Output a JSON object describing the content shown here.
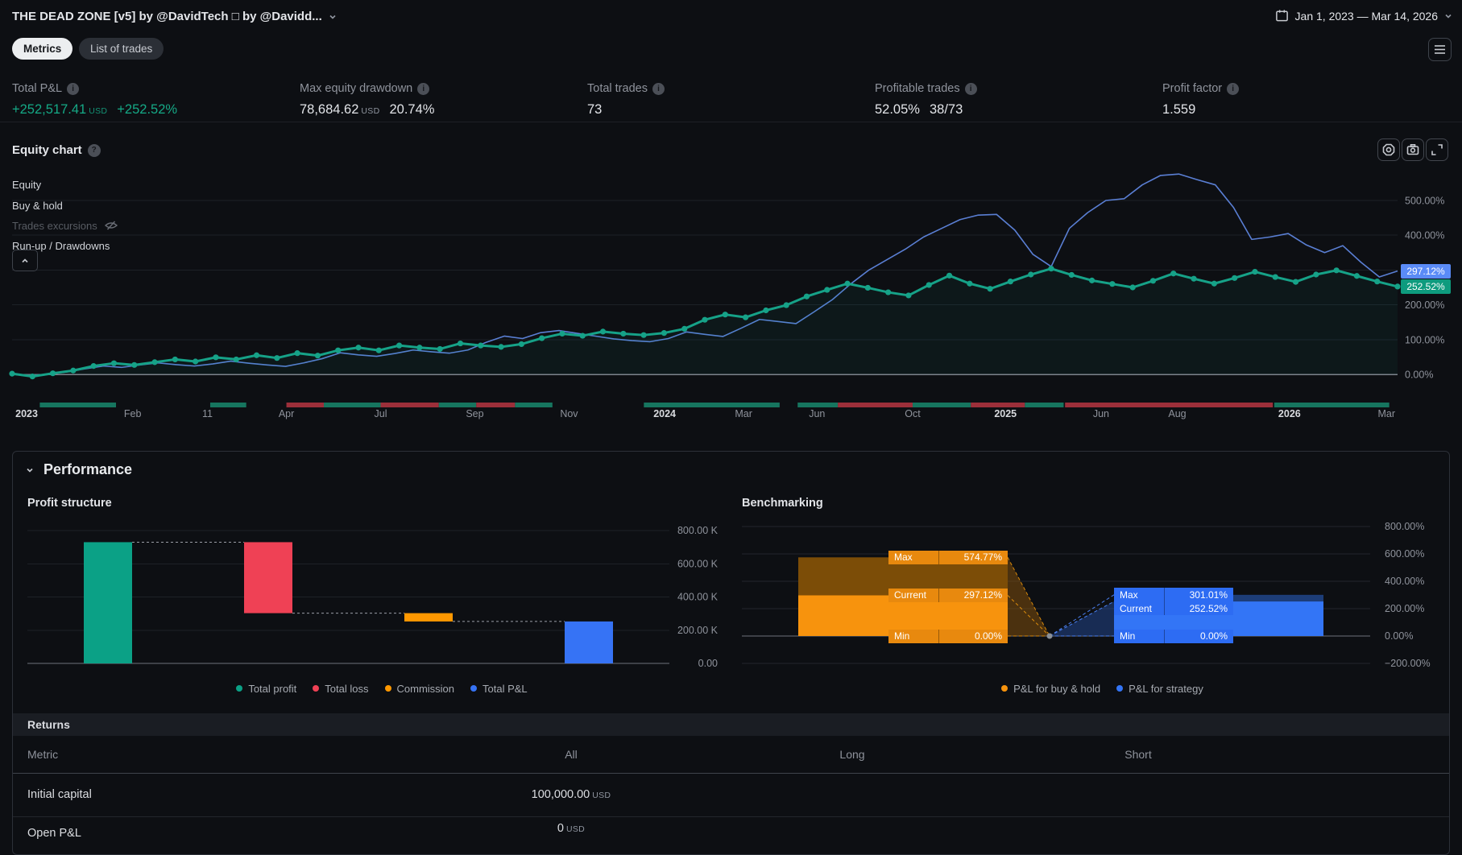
{
  "header": {
    "title": "THE DEAD ZONE [v5] by @DavidTech □ by @Davidd...",
    "date_range": "Jan 1, 2023 — Mar 14, 2026"
  },
  "tabs": {
    "metrics": "Metrics",
    "list_of_trades": "List of trades"
  },
  "metrics": {
    "total_pnl": {
      "label": "Total P&L",
      "value": "+252,517.41",
      "unit": "USD",
      "extra": "+252.52%"
    },
    "max_drawdown": {
      "label": "Max equity drawdown",
      "value": "78,684.62",
      "unit": "USD",
      "extra": "20.74%"
    },
    "total_trades": {
      "label": "Total trades",
      "value": "73"
    },
    "profitable_trades": {
      "label": "Profitable trades",
      "value": "52.05%",
      "extra": "38/73"
    },
    "profit_factor": {
      "label": "Profit factor",
      "value": "1.559"
    }
  },
  "equity_section": {
    "title": "Equity chart",
    "legend": [
      "Equity",
      "Buy & hold",
      "Trades excursions",
      "Run-up / Drawdowns"
    ]
  },
  "performance": {
    "title": "Performance",
    "profit_structure_title": "Profit structure",
    "benchmarking_title": "Benchmarking"
  },
  "returns_table": {
    "section_title": "Returns",
    "columns": [
      "Metric",
      "All",
      "Long",
      "Short"
    ],
    "rows": [
      {
        "metric": "Initial capital",
        "all": "100,000.00",
        "all_unit": "USD",
        "long": "",
        "short": ""
      },
      {
        "metric": "Open P&L",
        "all": "0",
        "all_unit": "USD",
        "long": "",
        "short": ""
      }
    ]
  },
  "colors": {
    "green": "#15a986",
    "blue_line": "#5a7fd4",
    "badge_blue": "#5a8bf7",
    "badge_green": "#0e9b7e",
    "grid": "#1d2127",
    "zero_line": "#7e828c",
    "win_bar": "#16755f",
    "loss_bar": "#9c2f3a",
    "axis_text": "#8f939c"
  },
  "chart_data": [
    {
      "name": "equity_chart",
      "type": "line",
      "title": "Equity chart",
      "ylabel": "P&L %",
      "ylim": [
        -40,
        640
      ],
      "yticks": [
        {
          "v": 500,
          "label": "500.00%"
        },
        {
          "v": 400,
          "label": "400.00%"
        },
        {
          "v": 300,
          "label": ""
        },
        {
          "v": 200,
          "label": "200.00%"
        },
        {
          "v": 100,
          "label": "100.00%"
        },
        {
          "v": 0,
          "label": "0.00%"
        }
      ],
      "badges": [
        {
          "value": 297.12,
          "label": "297.12%",
          "color": "#5a8bf7"
        },
        {
          "value": 252.52,
          "label": "252.52%",
          "color": "#0e9b7e"
        }
      ],
      "series": [
        {
          "name": "Buy & hold",
          "color": "#5a7fd4",
          "width": 1.6,
          "markers": false,
          "values": [
            0,
            -4,
            1,
            7,
            16,
            24,
            20,
            27,
            33,
            28,
            24,
            30,
            38,
            32,
            27,
            23,
            33,
            45,
            62,
            56,
            52,
            60,
            70,
            65,
            61,
            70,
            92,
            110,
            103,
            120,
            126,
            118,
            110,
            102,
            97,
            94,
            103,
            122,
            115,
            109,
            133,
            158,
            152,
            146,
            180,
            215,
            260,
            300,
            330,
            360,
            395,
            420,
            445,
            458,
            460,
            415,
            345,
            310,
            420,
            465,
            500,
            505,
            545,
            572,
            576,
            560,
            545,
            480,
            388,
            395,
            405,
            372,
            350,
            370,
            322,
            280,
            297.12
          ]
        },
        {
          "name": "Equity",
          "color": "#16a288",
          "width": 3,
          "markers": true,
          "area_fill": "rgba(18,162,134,0.07)",
          "values": [
            2,
            -6,
            3,
            11,
            24,
            32,
            27,
            35,
            43,
            37,
            49,
            43,
            55,
            47,
            61,
            54,
            69,
            77,
            69,
            83,
            77,
            73,
            89,
            83,
            79,
            87,
            104,
            117,
            111,
            123,
            117,
            113,
            119,
            131,
            157,
            172,
            164,
            184,
            199,
            224,
            243,
            261,
            249,
            236,
            227,
            257,
            284,
            261,
            246,
            267,
            287,
            304,
            286,
            270,
            260,
            250,
            269,
            290,
            275,
            261,
            277,
            295,
            280,
            266,
            287,
            299,
            283,
            267,
            252.52
          ]
        }
      ],
      "trade_bars": [
        {
          "from": 0.02,
          "to": 0.075,
          "type": "win"
        },
        {
          "from": 0.143,
          "to": 0.169,
          "type": "win"
        },
        {
          "from": 0.198,
          "to": 0.225,
          "type": "loss"
        },
        {
          "from": 0.225,
          "to": 0.266,
          "type": "win"
        },
        {
          "from": 0.266,
          "to": 0.308,
          "type": "loss"
        },
        {
          "from": 0.308,
          "to": 0.335,
          "type": "win"
        },
        {
          "from": 0.335,
          "to": 0.363,
          "type": "loss"
        },
        {
          "from": 0.363,
          "to": 0.39,
          "type": "win"
        },
        {
          "from": 0.456,
          "to": 0.554,
          "type": "win"
        },
        {
          "from": 0.567,
          "to": 0.596,
          "type": "win"
        },
        {
          "from": 0.596,
          "to": 0.65,
          "type": "loss"
        },
        {
          "from": 0.65,
          "to": 0.692,
          "type": "win"
        },
        {
          "from": 0.692,
          "to": 0.731,
          "type": "loss"
        },
        {
          "from": 0.731,
          "to": 0.759,
          "type": "win"
        },
        {
          "from": 0.76,
          "to": 0.91,
          "type": "loss"
        },
        {
          "from": 0.911,
          "to": 0.994,
          "type": "win"
        }
      ],
      "xlabels": [
        {
          "pos": 0.0105,
          "label": "2023",
          "major": true
        },
        {
          "pos": 0.087,
          "label": "Feb",
          "major": false
        },
        {
          "pos": 0.141,
          "label": "11",
          "major": false
        },
        {
          "pos": 0.198,
          "label": "Apr",
          "major": false
        },
        {
          "pos": 0.266,
          "label": "Jul",
          "major": false
        },
        {
          "pos": 0.334,
          "label": "Sep",
          "major": false
        },
        {
          "pos": 0.402,
          "label": "Nov",
          "major": false
        },
        {
          "pos": 0.471,
          "label": "2024",
          "major": true
        },
        {
          "pos": 0.528,
          "label": "Mar",
          "major": false
        },
        {
          "pos": 0.581,
          "label": "Jun",
          "major": false
        },
        {
          "pos": 0.65,
          "label": "Oct",
          "major": false
        },
        {
          "pos": 0.717,
          "label": "2025",
          "major": true
        },
        {
          "pos": 0.786,
          "label": "Jun",
          "major": false
        },
        {
          "pos": 0.841,
          "label": "Aug",
          "major": false
        },
        {
          "pos": 0.922,
          "label": "2026",
          "major": true
        },
        {
          "pos": 0.992,
          "label": "Mar",
          "major": false
        }
      ]
    },
    {
      "name": "profit_structure",
      "type": "waterfall",
      "title": "Profit structure",
      "items": [
        {
          "label": "Total profit",
          "value": 730000,
          "color": "#0ba186",
          "is_total": false
        },
        {
          "label": "Total loss",
          "value": -427500,
          "color": "#ef4155",
          "is_total": false
        },
        {
          "label": "Commission",
          "value": -50000,
          "color": "#ff9800",
          "is_total": false
        },
        {
          "label": "Total P&L",
          "value": 252517.41,
          "color": "#3673f5",
          "is_total": true
        }
      ],
      "yticks": [
        {
          "v": 800000,
          "label": "800.00 K"
        },
        {
          "v": 600000,
          "label": "600.00 K"
        },
        {
          "v": 400000,
          "label": "400.00 K"
        },
        {
          "v": 200000,
          "label": "200.00 K"
        },
        {
          "v": 0,
          "label": "0.00"
        }
      ]
    },
    {
      "name": "benchmarking",
      "type": "range-columns",
      "title": "Benchmarking",
      "groups": [
        {
          "name": "P&L for buy & hold",
          "color": "#f7930d",
          "color_dark": "#7c4d07",
          "badge_color": "#e8890e",
          "max": 574.77,
          "current": 297.12,
          "min": 0,
          "max_label": "574.77%",
          "current_label": "297.12%",
          "min_label": "0.00%",
          "row_labels": {
            "max": "Max",
            "current": "Current",
            "min": "Min"
          }
        },
        {
          "name": "P&L for strategy",
          "color": "#3375f6",
          "color_dark": "#1d3d78",
          "badge_color": "#2d6cf3",
          "max": 301.01,
          "current": 252.52,
          "min": 0,
          "max_label": "301.01%",
          "current_label": "252.52%",
          "min_label": "0.00%",
          "row_labels": {
            "max": "Max",
            "current": "Current",
            "min": "Min"
          }
        }
      ],
      "yticks": [
        {
          "v": 800,
          "label": "800.00%"
        },
        {
          "v": 600,
          "label": "600.00%"
        },
        {
          "v": 400,
          "label": "400.00%"
        },
        {
          "v": 200,
          "label": "200.00%"
        },
        {
          "v": 0,
          "label": "0.00%"
        },
        {
          "v": -200,
          "label": "−200.00%"
        }
      ]
    }
  ]
}
